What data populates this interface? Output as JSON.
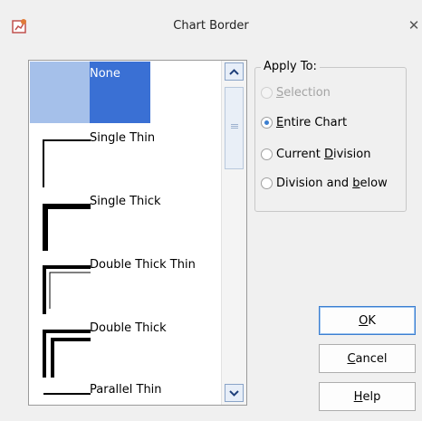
{
  "window": {
    "title": "Chart Border",
    "close_glyph": "✕"
  },
  "border_list": {
    "options": [
      {
        "label": "None",
        "selected": true
      },
      {
        "label": "Single Thin",
        "selected": false
      },
      {
        "label": "Single Thick",
        "selected": false
      },
      {
        "label": "Double Thick Thin",
        "selected": false
      },
      {
        "label": "Double Thick",
        "selected": false
      },
      {
        "label": "Parallel Thin",
        "selected": false
      }
    ],
    "selection_colors": {
      "left": "#a5c0ea",
      "right": "#3a70d4"
    }
  },
  "apply_to": {
    "legend": "Apply To:",
    "options": [
      {
        "pre": "",
        "key": "S",
        "post": "election",
        "enabled": false,
        "checked": false
      },
      {
        "pre": "",
        "key": "E",
        "post": "ntire Chart",
        "enabled": true,
        "checked": true
      },
      {
        "pre": "Current ",
        "key": "D",
        "post": "ivision",
        "enabled": true,
        "checked": false
      },
      {
        "pre": "Division and ",
        "key": "b",
        "post": "elow",
        "enabled": true,
        "checked": false
      }
    ]
  },
  "buttons": {
    "ok": {
      "key": "O",
      "post": "K"
    },
    "cancel": {
      "key": "C",
      "post": "ancel"
    },
    "help": {
      "key": "H",
      "post": "elp"
    }
  },
  "icons": {
    "app": "chart-app-icon",
    "scroll_up": "chevron-up-icon",
    "scroll_down": "chevron-down-icon",
    "close": "close-icon"
  }
}
